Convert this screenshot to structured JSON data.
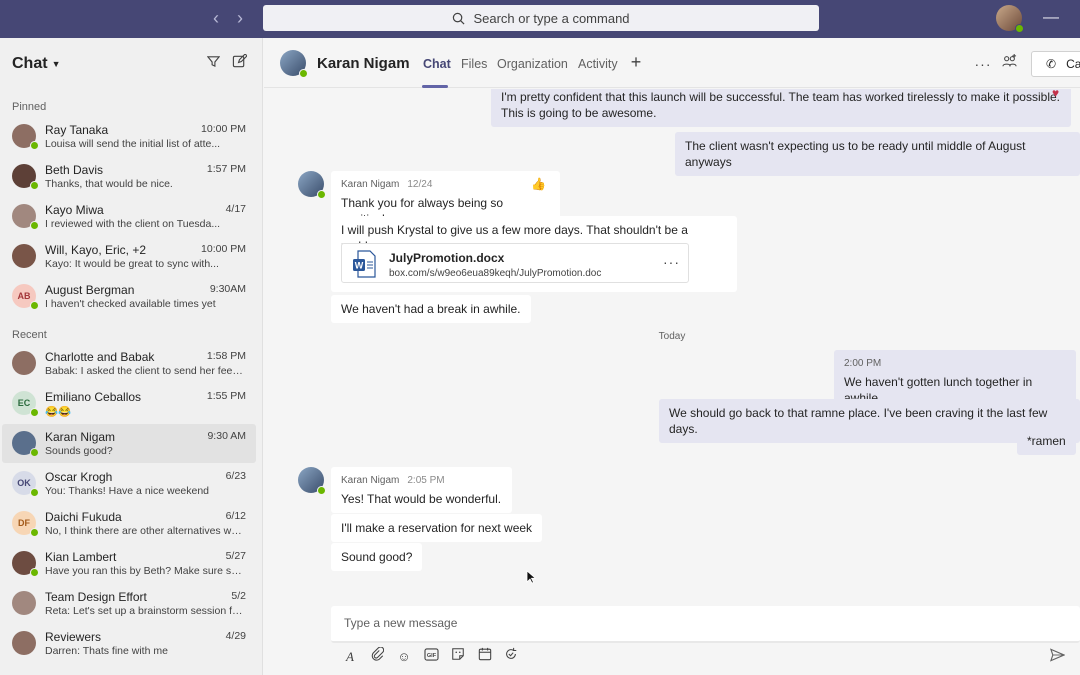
{
  "topbar": {
    "search_placeholder": "Search or type a command",
    "back_icon": "chevron-left-icon",
    "forward_icon": "chevron-right-icon",
    "minimize_icon": "minimize-icon"
  },
  "sidebar": {
    "title": "Chat",
    "pinned_label": "Pinned",
    "recent_label": "Recent",
    "pinned": [
      {
        "name": "Ray Tanaka",
        "time": "10:00 PM",
        "preview": "Louisa will send the initial list of atte...",
        "initials": "",
        "color": "#8d6e63"
      },
      {
        "name": "Beth Davis",
        "time": "1:57 PM",
        "preview": "Thanks, that would be nice.",
        "initials": "",
        "color": "#5d4037"
      },
      {
        "name": "Kayo Miwa",
        "time": "4/17",
        "preview": "I reviewed with the client on Tuesda...",
        "initials": "",
        "color": "#a1887f"
      },
      {
        "name": "Will, Kayo, Eric, +2",
        "time": "10:00 PM",
        "preview": "Kayo: It would be great to sync with...",
        "initials": "",
        "color": "#795548"
      },
      {
        "name": "August Bergman",
        "time": "9:30AM",
        "preview": "I haven't checked available times yet",
        "initials": "AB",
        "color": "#f6c9c0"
      }
    ],
    "recent": [
      {
        "name": "Charlotte and Babak",
        "time": "1:58 PM",
        "preview": "Babak: I asked the client to send her feed...",
        "initials": "",
        "color": "#8d6e63"
      },
      {
        "name": "Emiliano Ceballos",
        "time": "1:55 PM",
        "preview": "😂😂",
        "initials": "EC",
        "color": "#cfe3d4"
      },
      {
        "name": "Karan Nigam",
        "time": "9:30 AM",
        "preview": "Sounds good?",
        "initials": "",
        "color": "#5a6f8c"
      },
      {
        "name": "Oscar Krogh",
        "time": "6/23",
        "preview": "You: Thanks! Have a nice weekend",
        "initials": "OK",
        "color": "#d7dbe8"
      },
      {
        "name": "Daichi Fukuda",
        "time": "6/12",
        "preview": "No, I think there are other alternatives we c...",
        "initials": "DF",
        "color": "#f7d6b5"
      },
      {
        "name": "Kian Lambert",
        "time": "5/27",
        "preview": "Have you ran this by Beth? Make sure she is...",
        "initials": "",
        "color": "#6d4c41"
      },
      {
        "name": "Team Design Effort",
        "time": "5/2",
        "preview": "Reta: Let's set up a brainstorm session for...",
        "initials": "",
        "color": "#a1887f"
      },
      {
        "name": "Reviewers",
        "time": "4/29",
        "preview": "Darren: Thats fine with me",
        "initials": "",
        "color": "#8d6e63"
      }
    ]
  },
  "header": {
    "name": "Karan Nigam",
    "tabs": [
      "Chat",
      "Files",
      "Organization",
      "Activity"
    ],
    "call_label": "Ca"
  },
  "messages": {
    "m1": "I'm pretty confident that this launch will be successful. The team has worked tirelessly to make it possible. This is going to be awesome.",
    "m2": "The client wasn't expecting us to be ready until middle of August anyways",
    "k1_sender": "Karan Nigam",
    "k1_time": "12/24",
    "k1_text": "Thank you for always being so positive!",
    "k2_text": "I will push Krystal to give us a few more days. That shouldn't be a problem.",
    "file_name": "JulyPromotion.docx",
    "file_path": "box.com/s/w9eo6eua89keqh/JulyPromotion.doc",
    "k3_text": "We haven't had a break in awhile.",
    "date_separator": "Today",
    "m3_time": "2:00 PM",
    "m3_text": "We haven't gotten lunch together in awhile",
    "m4_text": "We should go back to that ramne place. I've been craving it the last few days.",
    "m5_text": "*ramen",
    "k4_sender": "Karan Nigam",
    "k4_time": "2:05 PM",
    "k4_text": "Yes! That would be wonderful.",
    "k5_text": "I'll make a reservation for next week",
    "k6_text": "Sound good?"
  },
  "compose": {
    "placeholder": "Type a new message"
  },
  "colors": {
    "brand": "#464775",
    "accent": "#6264a7",
    "presence": "#6bb700"
  }
}
